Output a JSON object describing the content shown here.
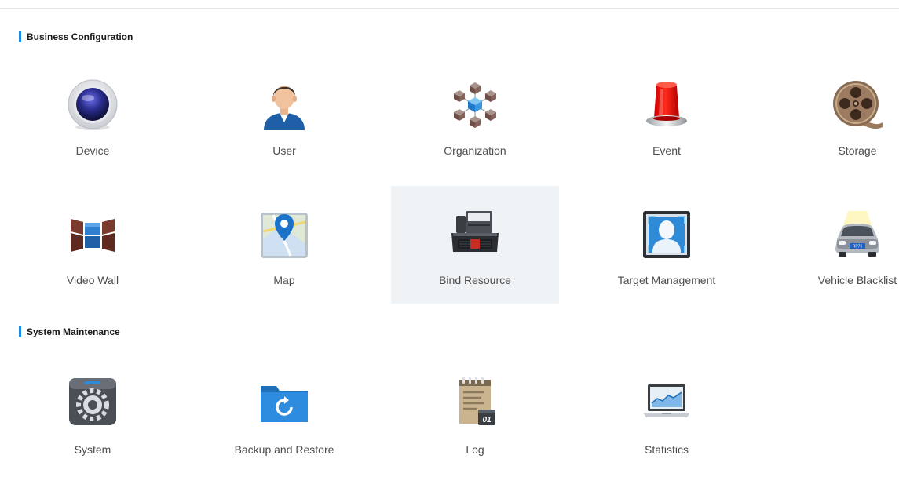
{
  "sections": [
    {
      "title": "Business Configuration"
    },
    {
      "title": "System Maintenance"
    }
  ],
  "business_items": [
    {
      "label": "Device",
      "icon": "device-camera-icon"
    },
    {
      "label": "User",
      "icon": "user-icon"
    },
    {
      "label": "Organization",
      "icon": "organization-icon"
    },
    {
      "label": "Event",
      "icon": "alarm-light-icon"
    },
    {
      "label": "Storage",
      "icon": "film-reel-icon"
    },
    {
      "label": "Video Wall",
      "icon": "video-wall-icon"
    },
    {
      "label": "Map",
      "icon": "map-pin-icon"
    },
    {
      "label": "Bind Resource",
      "icon": "bind-resource-icon",
      "selected": true
    },
    {
      "label": "Target Management",
      "icon": "target-face-icon"
    },
    {
      "label": "Vehicle Blacklist",
      "icon": "vehicle-icon",
      "plate": "RP76"
    }
  ],
  "maintenance_items": [
    {
      "label": "System",
      "icon": "system-gear-icon"
    },
    {
      "label": "Backup and Restore",
      "icon": "backup-folder-icon"
    },
    {
      "label": "Log",
      "icon": "log-notepad-icon",
      "date_badge": "01"
    },
    {
      "label": "Statistics",
      "icon": "statistics-laptop-icon"
    }
  ],
  "colors": {
    "accent": "#1f8ee8",
    "selected_bg": "#eff3f6",
    "text": "#4d4d4d"
  }
}
